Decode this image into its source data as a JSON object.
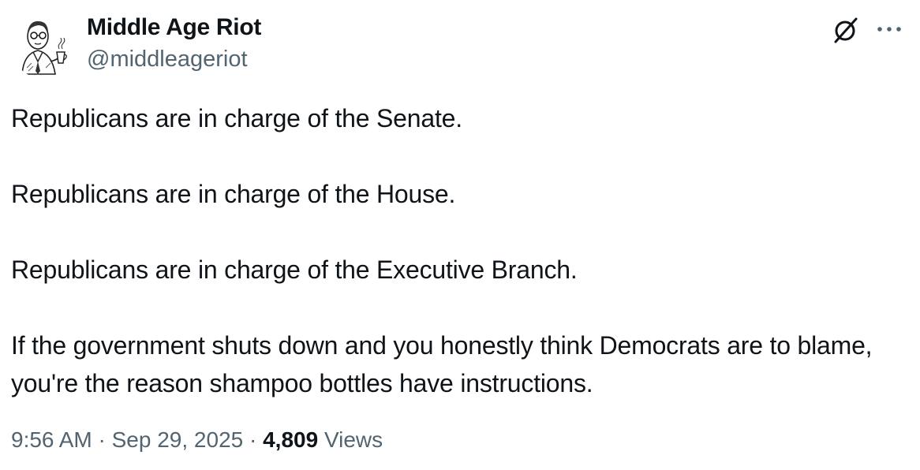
{
  "author": {
    "display_name": "Middle Age Riot",
    "handle": "@middleageriot",
    "avatar_icon": "vintage-man-drawing-avatar"
  },
  "actions": {
    "grok_icon": "slashed-circle-icon",
    "more_icon": "ellipsis-icon"
  },
  "tweet": {
    "paragraphs": [
      "Republicans are in charge of the Senate.",
      "Republicans are in charge of the House.",
      "Republicans are in charge of the Executive Branch.",
      "If the government shuts down and you honestly think Democrats are to blame, you're the reason shampoo bottles have instructions."
    ]
  },
  "meta": {
    "time": "9:56 AM",
    "separator": " · ",
    "date": "Sep 29, 2025",
    "views_count": "4,809",
    "views_label": "Views"
  },
  "colors": {
    "text_primary": "#0f1419",
    "text_secondary": "#536471",
    "background": "#ffffff"
  }
}
